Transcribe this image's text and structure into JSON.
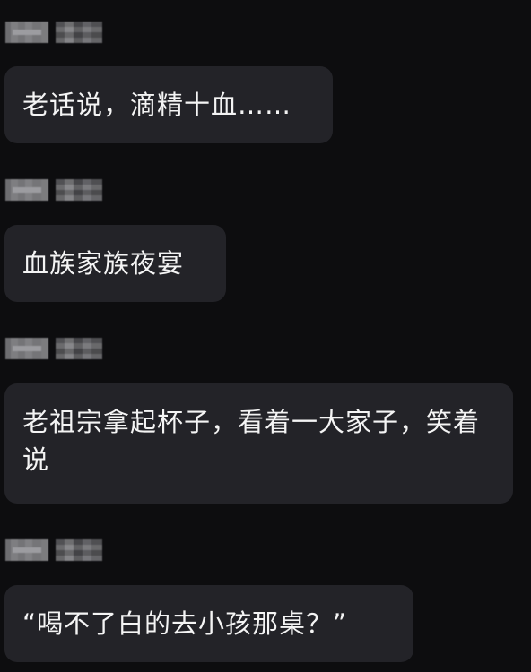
{
  "messages": [
    {
      "text": "老话说，滴精十血……"
    },
    {
      "text": "血族家族夜宴"
    },
    {
      "text": "老祖宗拿起杯子，看着一大家子，笑着说"
    },
    {
      "text": "“喝不了白的去小孩那桌？”"
    }
  ]
}
